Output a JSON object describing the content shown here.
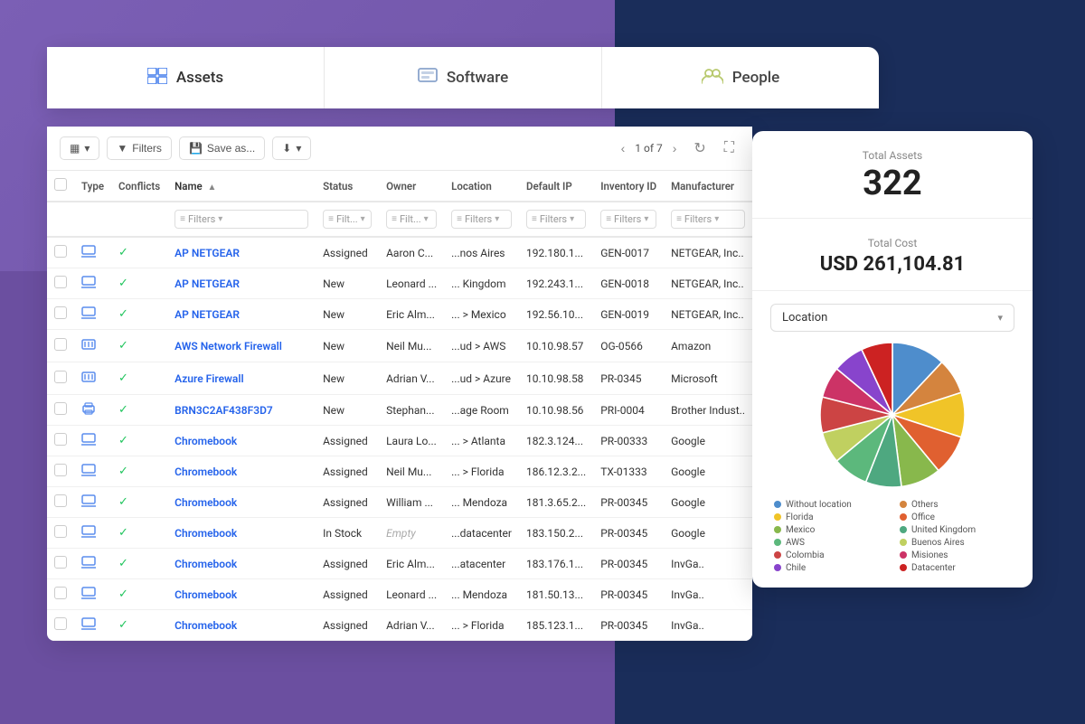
{
  "background": {
    "purple": "#7b5fb5",
    "dark_blue": "#1a2d5a",
    "medium_blue": "#1e3a6e"
  },
  "tabs": [
    {
      "id": "assets",
      "label": "Assets",
      "icon": "🖥",
      "active": true
    },
    {
      "id": "software",
      "label": "Software",
      "icon": "🗄",
      "active": false
    },
    {
      "id": "people",
      "label": "People",
      "icon": "👥",
      "active": false
    }
  ],
  "toolbar": {
    "view_btn": "▦",
    "filter_label": "Filters",
    "save_label": "Save as...",
    "download_label": "▼",
    "pagination_current": "1 of 7",
    "refresh": "↻",
    "fullscreen": "⛶"
  },
  "table": {
    "columns": [
      "",
      "Type",
      "Conflicts",
      "Name",
      "Status",
      "Owner",
      "Location",
      "Default IP",
      "Inventory ID",
      "Manufacturer"
    ],
    "filter_placeholders": [
      "Filters",
      "Filt...",
      "Filt...",
      "Filters",
      "Filters",
      "Filters",
      "Filters"
    ],
    "rows": [
      {
        "type": "laptop",
        "conflict": true,
        "name": "AP NETGEAR",
        "status": "Assigned",
        "owner": "Aaron C...",
        "location": "...nos Aires",
        "ip": "192.180.1...",
        "inv_id": "GEN-0017",
        "manufacturer": "NETGEAR, Inc.."
      },
      {
        "type": "laptop",
        "conflict": true,
        "name": "AP NETGEAR",
        "status": "New",
        "owner": "Leonard ...",
        "location": "... Kingdom",
        "ip": "192.243.1...",
        "inv_id": "GEN-0018",
        "manufacturer": "NETGEAR, Inc.."
      },
      {
        "type": "laptop",
        "conflict": true,
        "name": "AP NETGEAR",
        "status": "New",
        "owner": "Eric Alm...",
        "location": "... > Mexico",
        "ip": "192.56.10...",
        "inv_id": "GEN-0019",
        "manufacturer": "NETGEAR, Inc.."
      },
      {
        "type": "firewall",
        "conflict": true,
        "name": "AWS Network Firewall",
        "status": "New",
        "owner": "Neil Mu...",
        "location": "...ud > AWS",
        "ip": "10.10.98.57",
        "inv_id": "OG-0566",
        "manufacturer": "Amazon"
      },
      {
        "type": "firewall",
        "conflict": true,
        "name": "Azure Firewall",
        "status": "New",
        "owner": "Adrian V...",
        "location": "...ud > Azure",
        "ip": "10.10.98.58",
        "inv_id": "PR-0345",
        "manufacturer": "Microsoft"
      },
      {
        "type": "printer",
        "conflict": true,
        "name": "BRN3C2AF438F3D7",
        "status": "New",
        "owner": "Stephan...",
        "location": "...age Room",
        "ip": "10.10.98.56",
        "inv_id": "PRI-0004",
        "manufacturer": "Brother Indust.."
      },
      {
        "type": "laptop",
        "conflict": true,
        "name": "Chromebook",
        "status": "Assigned",
        "owner": "Laura Lo...",
        "location": "... > Atlanta",
        "ip": "182.3.124...",
        "inv_id": "PR-00333",
        "manufacturer": "Google"
      },
      {
        "type": "laptop",
        "conflict": true,
        "name": "Chromebook",
        "status": "Assigned",
        "owner": "Neil Mu...",
        "location": "... > Florida",
        "ip": "186.12.3.2...",
        "inv_id": "TX-01333",
        "manufacturer": "Google"
      },
      {
        "type": "laptop",
        "conflict": true,
        "name": "Chromebook",
        "status": "Assigned",
        "owner": "William ...",
        "location": "... Mendoza",
        "ip": "181.3.65.2...",
        "inv_id": "PR-00345",
        "manufacturer": "Google"
      },
      {
        "type": "laptop",
        "conflict": true,
        "name": "Chromebook",
        "status": "In Stock",
        "owner": null,
        "location": "...datacenter",
        "ip": "183.150.2...",
        "inv_id": "PR-00345",
        "manufacturer": "Google"
      },
      {
        "type": "laptop",
        "conflict": true,
        "name": "Chromebook",
        "status": "Assigned",
        "owner": "Eric Alm...",
        "location": "...atacenter",
        "ip": "183.176.1...",
        "inv_id": "PR-00345",
        "manufacturer": "InvGa.."
      },
      {
        "type": "laptop",
        "conflict": true,
        "name": "Chromebook",
        "status": "Assigned",
        "owner": "Leonard ...",
        "location": "... Mendoza",
        "ip": "181.50.13...",
        "inv_id": "PR-00345",
        "manufacturer": "InvGa.."
      },
      {
        "type": "laptop",
        "conflict": true,
        "name": "Chromebook",
        "status": "Assigned",
        "owner": "Adrian V...",
        "location": "... > Florida",
        "ip": "185.123.1...",
        "inv_id": "PR-00345",
        "manufacturer": "InvGa.."
      }
    ]
  },
  "stats_card": {
    "total_assets_label": "Total Assets",
    "total_assets_value": "322",
    "total_cost_label": "Total Cost",
    "total_cost_value": "USD 261,104.81",
    "location_dropdown_label": "Location",
    "pie_legend": [
      {
        "label": "Without location",
        "color": "#4e8dcc"
      },
      {
        "label": "Others",
        "color": "#d4843e"
      },
      {
        "label": "Florida",
        "color": "#f0c428"
      },
      {
        "label": "Office",
        "color": "#e06030"
      },
      {
        "label": "Mexico",
        "color": "#88b84c"
      },
      {
        "label": "United Kingdom",
        "color": "#4ea880"
      },
      {
        "label": "AWS",
        "color": "#5cb87c"
      },
      {
        "label": "Buenos Aires",
        "color": "#c0d060"
      },
      {
        "label": "Colombia",
        "color": "#cc4444"
      },
      {
        "label": "Misiones",
        "color": "#cc3366"
      },
      {
        "label": "Chile",
        "color": "#8844cc"
      },
      {
        "label": "Datacenter",
        "color": "#cc2222"
      }
    ],
    "pie_slices": [
      {
        "color": "#4e8dcc",
        "percent": 12
      },
      {
        "color": "#d4843e",
        "percent": 8
      },
      {
        "color": "#f0c428",
        "percent": 10
      },
      {
        "color": "#e06030",
        "percent": 9
      },
      {
        "color": "#88b84c",
        "percent": 9
      },
      {
        "color": "#4ea880",
        "percent": 8
      },
      {
        "color": "#5cb87c",
        "percent": 8
      },
      {
        "color": "#c0d060",
        "percent": 7
      },
      {
        "color": "#cc4444",
        "percent": 8
      },
      {
        "color": "#cc3366",
        "percent": 7
      },
      {
        "color": "#8844cc",
        "percent": 7
      },
      {
        "color": "#cc2222",
        "percent": 7
      }
    ]
  }
}
